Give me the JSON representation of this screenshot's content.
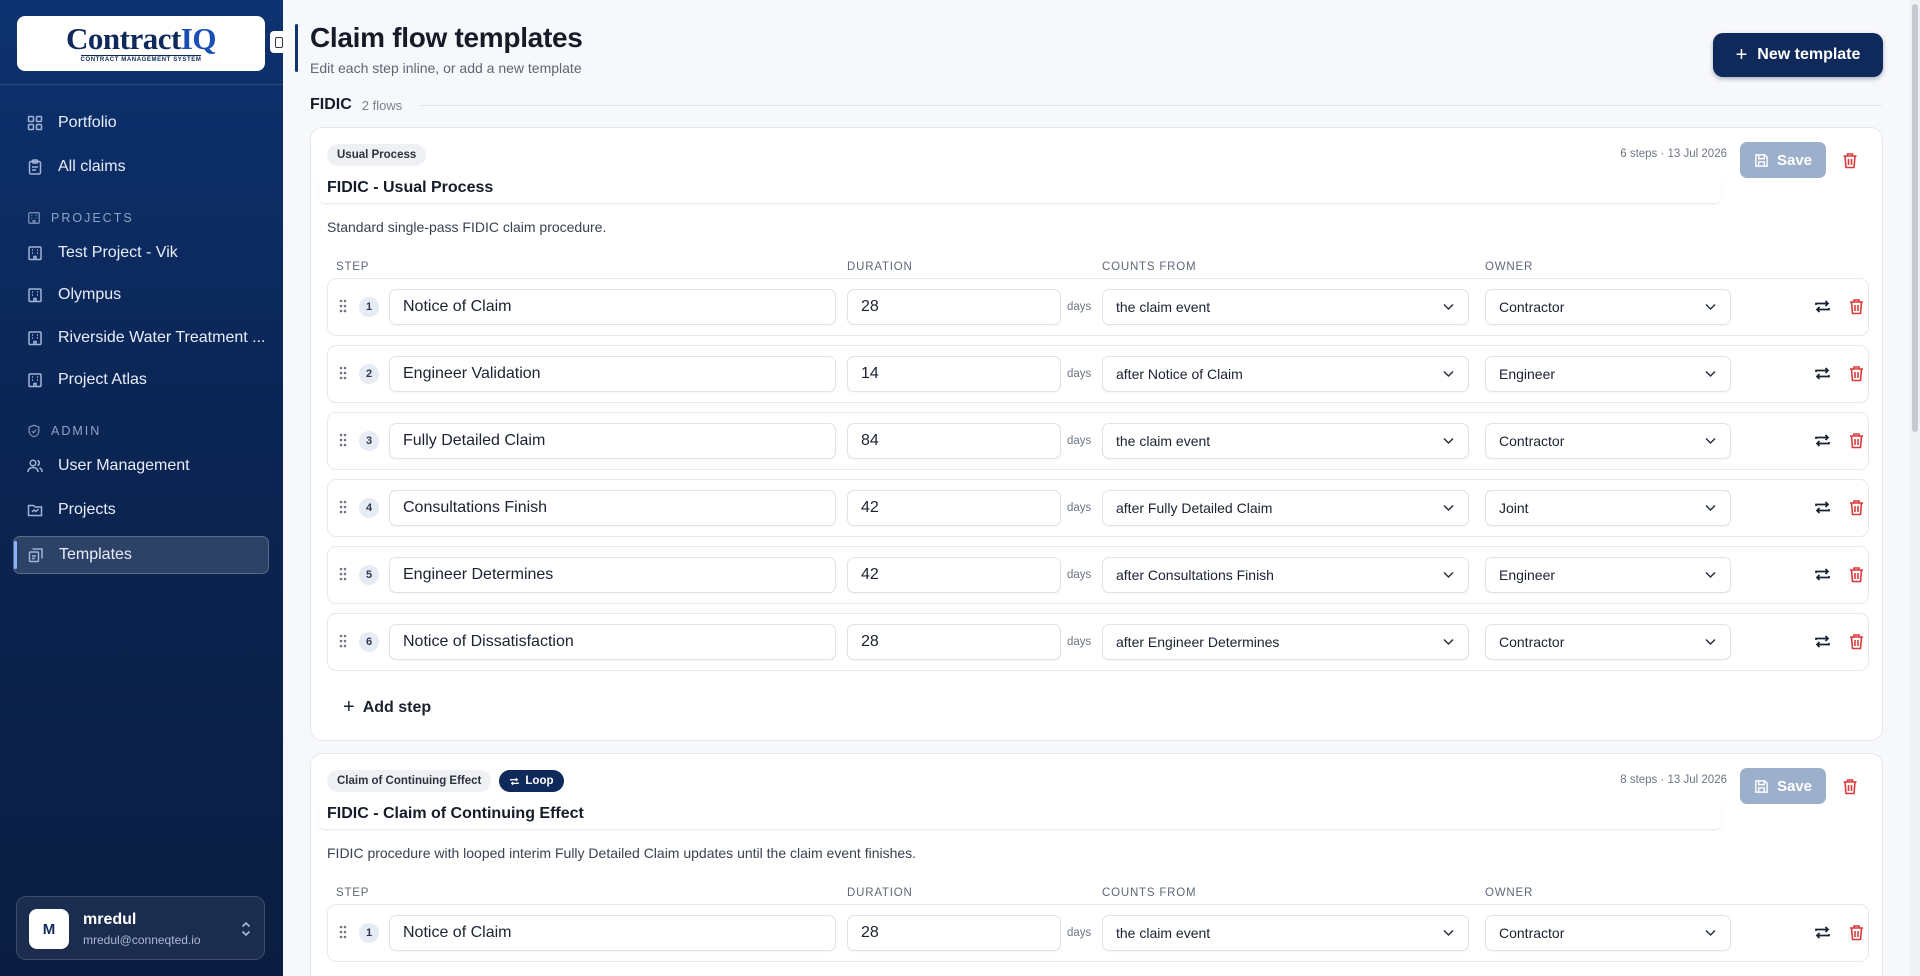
{
  "brand": {
    "name_main": "Contract",
    "name_accent": "IQ",
    "tagline": "CONTRACT MANAGEMENT SYSTEM"
  },
  "sidebar": {
    "top_items": [
      {
        "label": "Portfolio",
        "icon": "grid-icon"
      },
      {
        "label": "All claims",
        "icon": "clipboard-icon"
      }
    ],
    "projects_label": "PROJECTS",
    "projects": [
      {
        "label": "Test Project - Vik",
        "icon": "building-icon"
      },
      {
        "label": "Olympus",
        "icon": "building-icon"
      },
      {
        "label": "Riverside Water Treatment ...",
        "icon": "building-icon"
      },
      {
        "label": "Project Atlas",
        "icon": "building-icon"
      }
    ],
    "admin_label": "ADMIN",
    "admin": [
      {
        "label": "User Management",
        "icon": "users-icon"
      },
      {
        "label": "Projects",
        "icon": "folder-icon"
      },
      {
        "label": "Templates",
        "icon": "templates-icon",
        "active": true
      }
    ],
    "user": {
      "initial": "M",
      "name": "mredul",
      "email": "mredul@conneqted.io"
    }
  },
  "header": {
    "title": "Claim flow templates",
    "subtitle": "Edit each step inline, or add a new template",
    "new_button": "New template"
  },
  "group": {
    "name": "FIDIC",
    "count": "2 flows"
  },
  "columns": {
    "step": "STEP",
    "duration": "DURATION",
    "counts_from": "COUNTS FROM",
    "owner": "OWNER"
  },
  "days_unit": "days",
  "save_label": "Save",
  "add_step_label": "Add step",
  "templates": [
    {
      "badge": "Usual Process",
      "loop": false,
      "meta": "6 steps · 13 Jul 2026",
      "name": "FIDIC - Usual Process",
      "description": "Standard single-pass FIDIC claim procedure.",
      "steps": [
        {
          "num": "1",
          "name": "Notice of Claim",
          "duration": "28",
          "counts_from": "the claim event",
          "owner": "Contractor"
        },
        {
          "num": "2",
          "name": "Engineer Validation",
          "duration": "14",
          "counts_from": "after Notice of Claim",
          "owner": "Engineer"
        },
        {
          "num": "3",
          "name": "Fully Detailed Claim",
          "duration": "84",
          "counts_from": "the claim event",
          "owner": "Contractor"
        },
        {
          "num": "4",
          "name": "Consultations Finish",
          "duration": "42",
          "counts_from": "after Fully Detailed Claim",
          "owner": "Joint"
        },
        {
          "num": "5",
          "name": "Engineer Determines",
          "duration": "42",
          "counts_from": "after Consultations Finish",
          "owner": "Engineer"
        },
        {
          "num": "6",
          "name": "Notice of Dissatisfaction",
          "duration": "28",
          "counts_from": "after Engineer Determines",
          "owner": "Contractor"
        }
      ]
    },
    {
      "badge": "Claim of Continuing Effect",
      "loop": true,
      "loop_label": "Loop",
      "meta": "8 steps · 13 Jul 2026",
      "name": "FIDIC - Claim of Continuing Effect",
      "description": "FIDIC procedure with looped interim Fully Detailed Claim updates until the claim event finishes.",
      "steps": [
        {
          "num": "1",
          "name": "Notice of Claim",
          "duration": "28",
          "counts_from": "the claim event",
          "owner": "Contractor"
        }
      ]
    }
  ]
}
